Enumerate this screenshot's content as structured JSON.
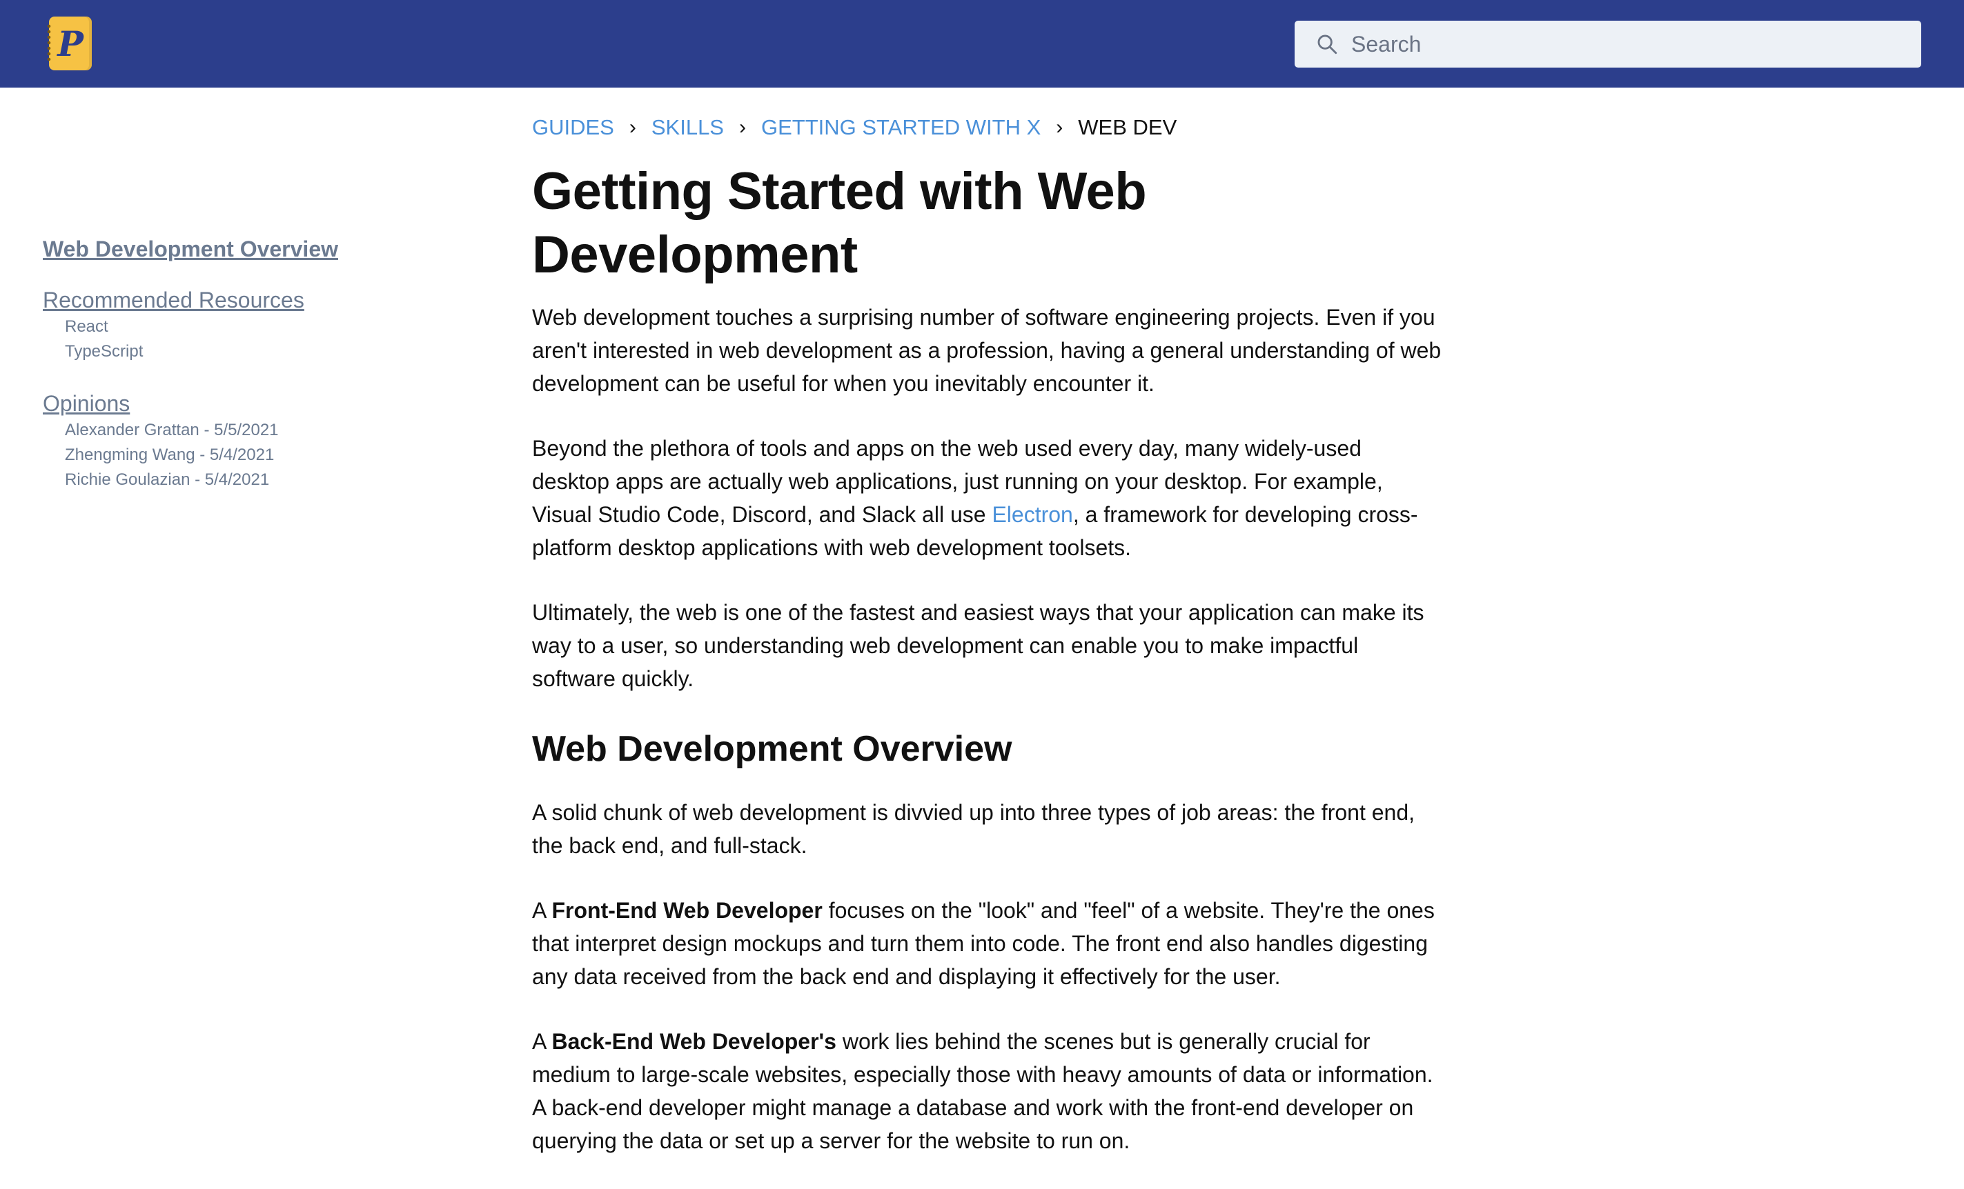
{
  "header": {
    "logo_letter": "P",
    "search_placeholder": "Search",
    "accent_color": "#2c3e8c",
    "logo_color": "#f6c244"
  },
  "sidebar": {
    "sections": [
      {
        "label": "Web Development Overview",
        "active": true,
        "items": []
      },
      {
        "label": "Recommended Resources",
        "items": [
          "React",
          "TypeScript"
        ]
      },
      {
        "label": "Opinions",
        "items": [
          "Alexander Grattan - 5/5/2021",
          "Zhengming Wang - 5/4/2021",
          "Richie Goulazian - 5/4/2021"
        ]
      }
    ]
  },
  "breadcrumb": {
    "items": [
      "GUIDES",
      "SKILLS",
      "GETTING STARTED WITH X"
    ],
    "current": "WEB DEV",
    "separator": "›"
  },
  "article": {
    "title": "Getting Started with Web Development",
    "intro": [
      "Web development touches a surprising number of software engineering projects. Even if you aren't interested in web development as a profession, having a general understanding of web development can be useful for when you inevitably encounter it.",
      {
        "before": "Beyond the plethora of tools and apps on the web used every day, many widely-used desktop apps are actually web applications, just running on your desktop. For example, Visual Studio Code, Discord, and Slack all use ",
        "link": "Electron",
        "after": ", a framework for developing cross-platform desktop applications with web development toolsets."
      },
      "Ultimately, the web is one of the fastest and easiest ways that your application can make its way to a user, so understanding web development can enable you to make impactful software quickly."
    ],
    "section_title": "Web Development Overview",
    "section_intro": "A solid chunk of web development is divvied up into three types of job areas: the front end, the back end, and full-stack.",
    "front_end": {
      "prefix": "A ",
      "bold": "Front-End Web Developer",
      "rest": " focuses on the \"look\" and \"feel\" of a website. They're the ones that interpret design mockups and turn them into code. The front end also handles digesting any data received from the back end and displaying it effectively for the user."
    },
    "back_end": {
      "prefix": "A ",
      "bold": "Back-End Web Developer's",
      "rest": " work lies behind the scenes but is generally crucial for medium to large-scale websites, especially those with heavy amounts of data or information. A back-end developer might manage a database and work with the front-end developer on querying the data or set up a server for the website to run on."
    }
  }
}
